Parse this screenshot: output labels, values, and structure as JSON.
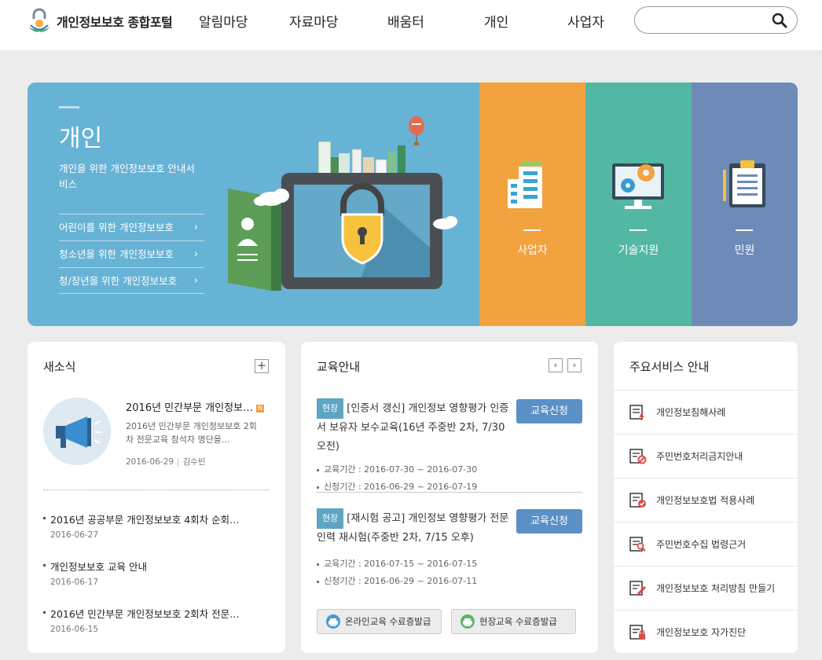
{
  "header": {
    "logo_text": "개인정보보호 종합포털",
    "nav": [
      "알림마당",
      "자료마당",
      "배움터",
      "개인",
      "사업자"
    ],
    "search_placeholder": ""
  },
  "hero": {
    "title": "개인",
    "description": "개인을 위한 개인정보보호 안내서비스",
    "links": [
      "어린이를 위한 개인정보보호",
      "청소년을 위한 개인정보보호",
      "청/장년을 위한 개인정보보호"
    ],
    "tiles": [
      {
        "label": "사업자",
        "color": "#f2a23f"
      },
      {
        "label": "기술지원",
        "color": "#53b8a3"
      },
      {
        "label": "민원",
        "color": "#6d8ab8"
      }
    ],
    "main_color": "#67b3d5"
  },
  "news": {
    "title": "새소식",
    "plus": "+",
    "feature": {
      "title": "2016년 민간부문 개인정보…",
      "badge": "N",
      "description": "2016년 민간부문 개인정보보호 2회차 전문교육 참석자 명단을…",
      "date": "2016-06-29",
      "author": "김수빈"
    },
    "items": [
      {
        "title": "2016년 공공부문 개인정보보호 4회차 순회…",
        "date": "2016-06-27"
      },
      {
        "title": "개인정보보호 교육 안내",
        "date": "2016-06-17"
      },
      {
        "title": "2016년 민간부문 개인정보보호 2회차 전문…",
        "date": "2016-06-15"
      }
    ]
  },
  "education": {
    "title": "교육안내",
    "prev": "‹",
    "next": "›",
    "apply_label": "교육신청",
    "items": [
      {
        "tag": "현장",
        "title": "[인증서 갱신] 개인정보 영향평가 인증서 보유자 보수교육(16년 주중반 2차, 7/30 오전)",
        "edu_period": "교육기간 : 2016-07-30 ~ 2016-07-30",
        "apply_period": "신청기간 : 2016-06-29 ~ 2016-07-19"
      },
      {
        "tag": "현장",
        "title": "[재시험 공고] 개인정보 영향평가 전문인력 재시험(주중반 2차, 7/15 오후)",
        "edu_period": "교육기간 : 2016-07-15 ~ 2016-07-15",
        "apply_period": "신청기간 : 2016-06-29 ~ 2016-07-11"
      }
    ],
    "cert_online": "온라인교육 수료증발급",
    "cert_offline": "현장교육 수료증발급"
  },
  "services": {
    "title": "주요서비스 안내",
    "items": [
      "개인정보침해사례",
      "주민번호처리금지안내",
      "개인정보보호법 적용사례",
      "주민번호수집 법령근거",
      "개인정보보호 처리방침 만들기",
      "개인정보보호 자가진단"
    ]
  }
}
